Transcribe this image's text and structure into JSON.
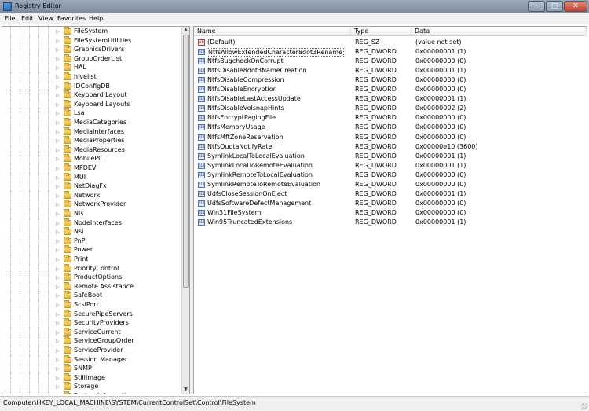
{
  "window": {
    "title": "Registry Editor",
    "min": "–",
    "max": "□",
    "close": "✕"
  },
  "menu": [
    "File",
    "Edit",
    "View",
    "Favorites",
    "Help"
  ],
  "tree": {
    "items": [
      "FileSystem",
      "FileSystemUtilities",
      "GraphicsDrivers",
      "GroupOrderList",
      "HAL",
      "hivelist",
      "IDConfigDB",
      "Keyboard Layout",
      "Keyboard Layouts",
      "Lsa",
      "MediaCategories",
      "MediaInterfaces",
      "MediaProperties",
      "MediaResources",
      "MobilePC",
      "MPDEV",
      "MUI",
      "NetDiagFx",
      "Network",
      "NetworkProvider",
      "Nls",
      "NodeInterfaces",
      "Nsi",
      "PnP",
      "Power",
      "Print",
      "PriorityControl",
      "ProductOptions",
      "Remote Assistance",
      "SafeBoot",
      "ScsiPort",
      "SecurePipeServers",
      "SecurityProviders",
      "ServiceCurrent",
      "ServiceGroupOrder",
      "ServiceProvider",
      "Session Manager",
      "SNMP",
      "StillImage",
      "Storage",
      "SystemInformation"
    ]
  },
  "list": {
    "columns": {
      "name": "Name",
      "type": "Type",
      "data": "Data"
    },
    "rows": [
      {
        "name": "(Default)",
        "type": "REG_SZ",
        "data": "(value not set)",
        "icon": "ab"
      },
      {
        "name": "NtfsAllowExtendedCharacter8dot3Rename",
        "type": "REG_DWORD",
        "data": "0x00000001 (1)",
        "icon": "011"
      },
      {
        "name": "NtfsBugcheckOnCorrupt",
        "type": "REG_DWORD",
        "data": "0x00000000 (0)",
        "icon": "011"
      },
      {
        "name": "NtfsDisable8dot3NameCreation",
        "type": "REG_DWORD",
        "data": "0x00000001 (1)",
        "icon": "011"
      },
      {
        "name": "NtfsDisableCompression",
        "type": "REG_DWORD",
        "data": "0x00000000 (0)",
        "icon": "011"
      },
      {
        "name": "NtfsDisableEncryption",
        "type": "REG_DWORD",
        "data": "0x00000000 (0)",
        "icon": "011"
      },
      {
        "name": "NtfsDisableLastAccessUpdate",
        "type": "REG_DWORD",
        "data": "0x00000001 (1)",
        "icon": "011"
      },
      {
        "name": "NtfsDisableVolsnapHints",
        "type": "REG_DWORD",
        "data": "0x00000002 (2)",
        "icon": "011"
      },
      {
        "name": "NtfsEncryptPagingFile",
        "type": "REG_DWORD",
        "data": "0x00000000 (0)",
        "icon": "011"
      },
      {
        "name": "NtfsMemoryUsage",
        "type": "REG_DWORD",
        "data": "0x00000000 (0)",
        "icon": "011"
      },
      {
        "name": "NtfsMftZoneReservation",
        "type": "REG_DWORD",
        "data": "0x00000000 (0)",
        "icon": "011"
      },
      {
        "name": "NtfsQuotaNotifyRate",
        "type": "REG_DWORD",
        "data": "0x00000e10 (3600)",
        "icon": "011"
      },
      {
        "name": "SymlinkLocalToLocalEvaluation",
        "type": "REG_DWORD",
        "data": "0x00000001 (1)",
        "icon": "011"
      },
      {
        "name": "SymlinkLocalToRemoteEvaluation",
        "type": "REG_DWORD",
        "data": "0x00000001 (1)",
        "icon": "011"
      },
      {
        "name": "SymlinkRemoteToLocalEvaluation",
        "type": "REG_DWORD",
        "data": "0x00000000 (0)",
        "icon": "011"
      },
      {
        "name": "SymlinkRemoteToRemoteEvaluation",
        "type": "REG_DWORD",
        "data": "0x00000000 (0)",
        "icon": "011"
      },
      {
        "name": "UdfsCloseSessionOnEject",
        "type": "REG_DWORD",
        "data": "0x00000001 (1)",
        "icon": "011"
      },
      {
        "name": "UdfsSoftwareDefectManagement",
        "type": "REG_DWORD",
        "data": "0x00000000 (0)",
        "icon": "011"
      },
      {
        "name": "Win31FileSystem",
        "type": "REG_DWORD",
        "data": "0x00000000 (0)",
        "icon": "011"
      },
      {
        "name": "Win95TruncatedExtensions",
        "type": "REG_DWORD",
        "data": "0x00000001 (1)",
        "icon": "011"
      }
    ]
  },
  "status": {
    "path": "Computer\\HKEY_LOCAL_MACHINE\\SYSTEM\\CurrentControlSet\\Control\\FileSystem"
  }
}
